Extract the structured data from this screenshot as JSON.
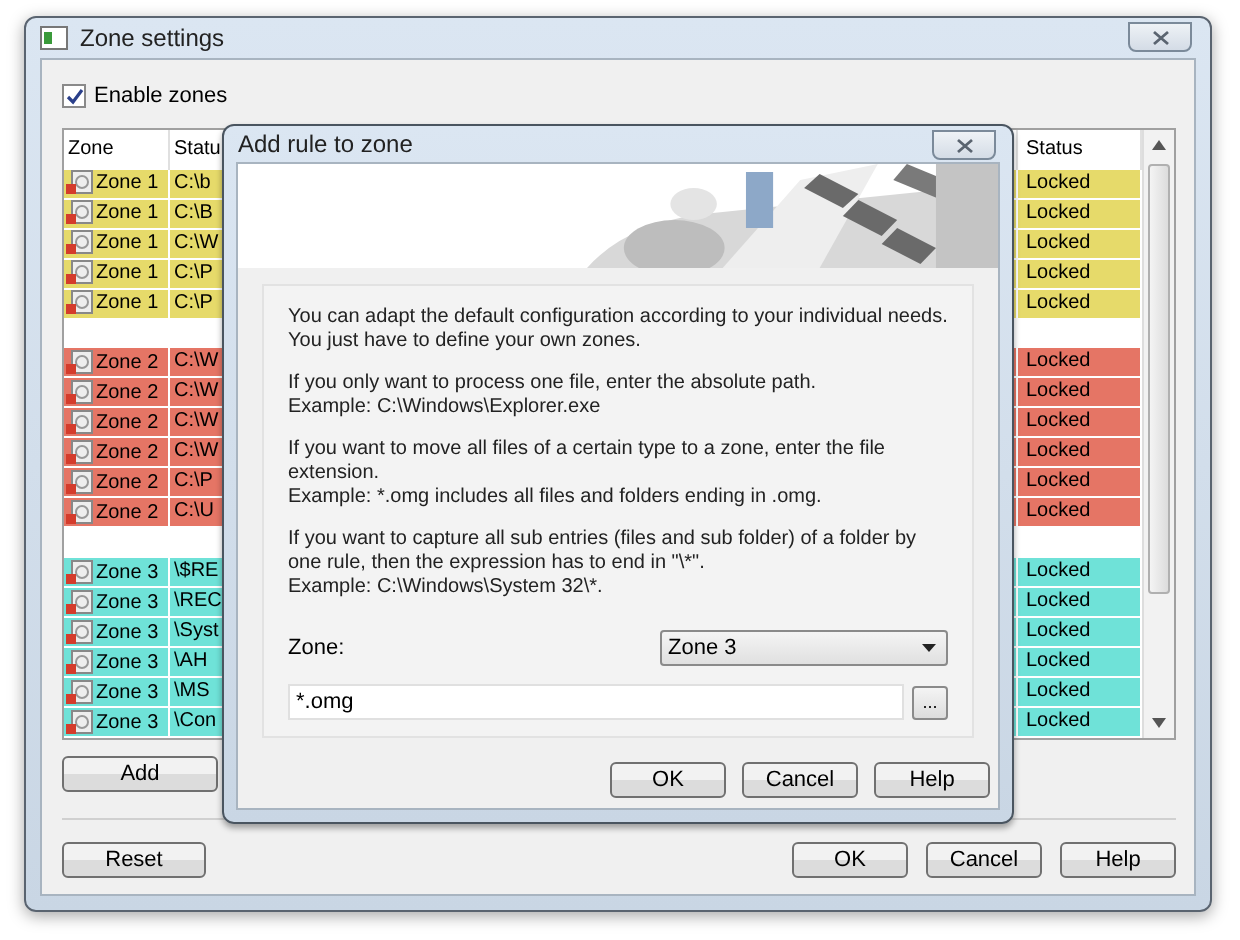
{
  "window": {
    "title": "Zone settings"
  },
  "enable_zones": {
    "label": "Enable zones",
    "checked": true
  },
  "table": {
    "columns": [
      "Zone",
      "Statu",
      "Status"
    ],
    "groups": [
      {
        "color": "#e6da6a",
        "rows": [
          {
            "zone": "Zone 1",
            "path": "C:\\b",
            "status": "Locked"
          },
          {
            "zone": "Zone 1",
            "path": "C:\\B",
            "status": "Locked"
          },
          {
            "zone": "Zone 1",
            "path": "C:\\W",
            "status": "Locked"
          },
          {
            "zone": "Zone 1",
            "path": "C:\\P",
            "status": "Locked"
          },
          {
            "zone": "Zone 1",
            "path": "C:\\P",
            "status": "Locked"
          }
        ]
      },
      {
        "color": "#e57565",
        "rows": [
          {
            "zone": "Zone 2",
            "path": "C:\\W",
            "status": "Locked"
          },
          {
            "zone": "Zone 2",
            "path": "C:\\W",
            "status": "Locked"
          },
          {
            "zone": "Zone 2",
            "path": "C:\\W",
            "status": "Locked"
          },
          {
            "zone": "Zone 2",
            "path": "C:\\W",
            "status": "Locked"
          },
          {
            "zone": "Zone 2",
            "path": "C:\\P",
            "status": "Locked"
          },
          {
            "zone": "Zone 2",
            "path": "C:\\U",
            "status": "Locked"
          }
        ]
      },
      {
        "color": "#6fe2d8",
        "rows": [
          {
            "zone": "Zone 3",
            "path": "\\$RE",
            "status": "Locked"
          },
          {
            "zone": "Zone 3",
            "path": "\\REC",
            "status": "Locked"
          },
          {
            "zone": "Zone 3",
            "path": "\\Syst",
            "status": "Locked"
          },
          {
            "zone": "Zone 3",
            "path": "\\AH",
            "status": "Locked"
          },
          {
            "zone": "Zone 3",
            "path": "\\MS",
            "status": "Locked"
          },
          {
            "zone": "Zone 3",
            "path": "\\Con",
            "status": "Locked"
          }
        ]
      }
    ]
  },
  "add_button": "Add",
  "reset_button": "Reset",
  "buttons": [
    "OK",
    "Cancel",
    "Help"
  ],
  "dialog": {
    "title": "Add rule to zone",
    "paragraphs": [
      [
        "You can adapt the default configuration according to your individual needs. You just have to define your own zones."
      ],
      [
        "If you only want to process one file, enter the absolute path.",
        "Example: C:\\Windows\\Explorer.exe"
      ],
      [
        "If you want to move all files of a certain type to a zone, enter the file extension.",
        "Example: *.omg includes all files and folders ending in .omg."
      ],
      [
        "If you want to capture all sub entries (files and sub folder) of a folder by one rule, then the expression has to end in \"\\*\".",
        "Example: C:\\Windows\\System 32\\*."
      ]
    ],
    "zone_label": "Zone:",
    "zone_select": "Zone 3",
    "pattern_value": "*.omg",
    "browse_button": "...",
    "buttons": [
      "OK",
      "Cancel",
      "Help"
    ]
  }
}
